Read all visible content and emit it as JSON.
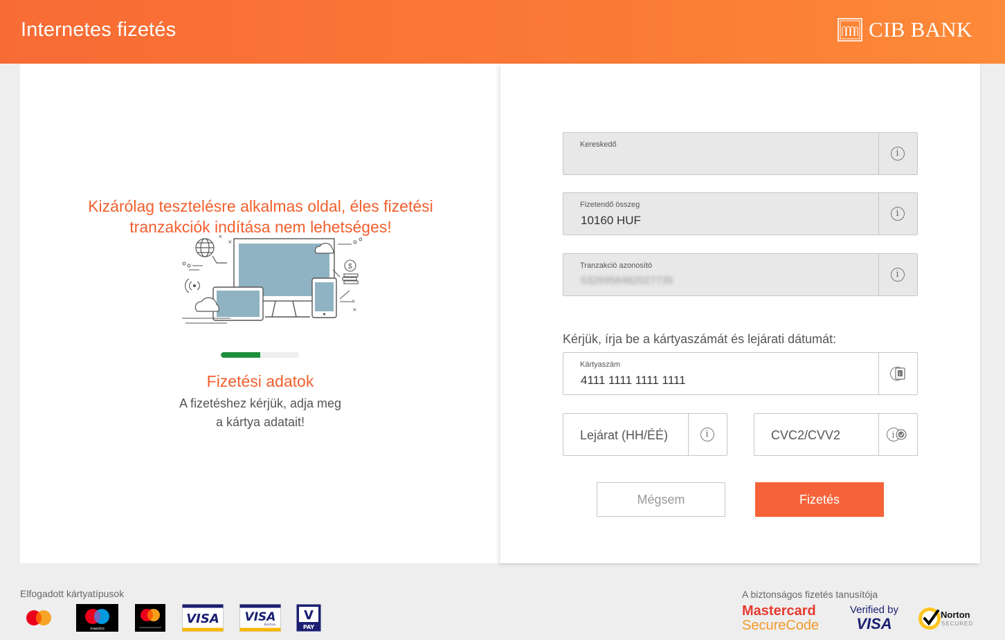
{
  "header": {
    "title": "Internetes fizetés",
    "bank_name": "CIB BANK"
  },
  "left": {
    "warning": "Kizárólag tesztelésre alkalmas oldal, éles fizetési tranzakciók indítása nem lehetséges!",
    "progress_fraction": 0.5,
    "step_title": "Fizetési adatok",
    "step_desc_line1": "A fizetéshez kérjük, adja meg",
    "step_desc_line2": "a kártya adatait!"
  },
  "form": {
    "merchant": {
      "label": "Kereskedő",
      "value": ""
    },
    "amount": {
      "label": "Fizetendő összeg",
      "value": "10160 HUF"
    },
    "transaction": {
      "label": "Tranzakció azonosító",
      "value": "5326956482027735"
    },
    "prompt": "Kérjük, írja be a kártyaszámát és lejárati dátumát:",
    "card_number": {
      "label": "Kártyaszám",
      "value": "4111 1111 1111 1111"
    },
    "expiry": {
      "placeholder": "Lejárat (HH/ÉÉ)"
    },
    "cvc": {
      "placeholder": "CVC2/CVV2"
    },
    "cancel_label": "Mégsem",
    "pay_label": "Fizetés"
  },
  "footer": {
    "accepted_cards_title": "Elfogadott kártyatípusok",
    "accepted_cards": [
      "mastercard-icon",
      "maestro-icon",
      "mastercard-electronic-icon",
      "visa-icon",
      "visa-electron-icon",
      "vpay-icon"
    ],
    "security_title": "A biztonságos fizetés tanusítója",
    "securecode_line1": "Mastercard",
    "securecode_line2": "SecureCode",
    "verified_line1": "Verified by",
    "verified_line2": "VISA",
    "norton_line1": "Norton",
    "norton_line2": "SECURED"
  },
  "colors": {
    "brand_orange": "#f86b35",
    "accent_red_orange": "#f15f2d",
    "progress_green": "#1b8f3a"
  }
}
